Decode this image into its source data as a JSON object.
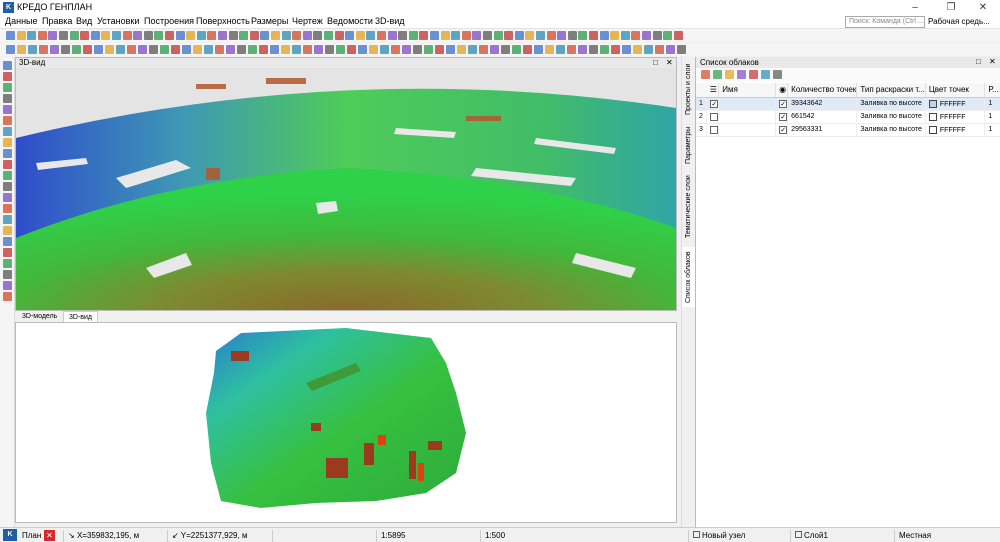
{
  "app": {
    "title": "КРЕДО ГЕНПЛАН",
    "icon_label": "K"
  },
  "window_controls": [
    "minimize-icon",
    "maximize-icon",
    "close-icon"
  ],
  "menu": {
    "items": [
      "Данные",
      "Правка",
      "Вид",
      "Установки",
      "Построения",
      "Поверхность",
      "Размеры",
      "Чертеж",
      "Ведомости",
      "3D-вид"
    ],
    "search_placeholder": "Поиск: Команда (Ctrl ...",
    "workspace_label": "Рабочая средь..."
  },
  "view3d": {
    "title": "3D-вид"
  },
  "bottom_tabs": {
    "items": [
      "3D-модель",
      "3D-вид"
    ],
    "active_index": 1
  },
  "side_tabs": [
    "Проекты и слои",
    "Параметры",
    "Тематические слои",
    "Список облаков"
  ],
  "cloud_panel": {
    "title": "Список облаков",
    "columns": [
      "Имя",
      "Количество точек",
      "Тип раскраски т...",
      "Цвет точек",
      "Р..."
    ],
    "rows": [
      {
        "index": "1",
        "visible": true,
        "count": "39343642",
        "coloring": "Заливка по высоте",
        "color": "FFFFFF",
        "swatch": "#b8d4f0",
        "extra": "1",
        "selected": true
      },
      {
        "index": "2",
        "visible": true,
        "count": "661542",
        "coloring": "Заливка по высоте",
        "color": "FFFFFF",
        "swatch": "#ffffff",
        "extra": "1",
        "selected": false
      },
      {
        "index": "3",
        "visible": true,
        "count": "29563331",
        "coloring": "Заливка по высоте",
        "color": "FFFFFF",
        "swatch": "#ffffff",
        "extra": "1",
        "selected": false
      }
    ]
  },
  "status": {
    "plan_tab": "План",
    "x_coord": "X=359832,195, м",
    "y_coord": "Y=2251377,929, м",
    "scale1": "1:5895",
    "scale2": "1:500",
    "node": "Новый узел",
    "layer": "Слой1",
    "system": "Местная"
  }
}
